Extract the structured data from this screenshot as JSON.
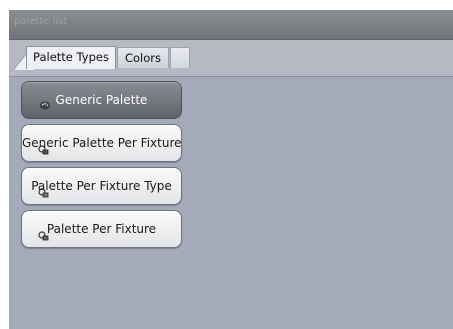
{
  "window": {
    "title": "palette list"
  },
  "tabs": [
    {
      "label": "Palette Types",
      "active": true
    },
    {
      "label": "Colors",
      "active": false
    },
    {
      "label": "",
      "active": false
    }
  ],
  "palette_buttons": [
    {
      "label": "Generic Palette",
      "icon": "palette-icon",
      "selected": true
    },
    {
      "label": "Generic Palette Per Fixture",
      "icon": "fixture-palette-icon",
      "selected": false
    },
    {
      "label": "Palette Per Fixture Type",
      "icon": "fixture-type-palette-icon",
      "selected": false
    },
    {
      "label": "Palette Per Fixture",
      "icon": "fixture-palette-icon",
      "selected": false
    }
  ],
  "colors": {
    "background": "#a4aab9",
    "titlebar": "#7c8085",
    "selected_button": "#6e7177",
    "button": "#f0f0f2"
  }
}
